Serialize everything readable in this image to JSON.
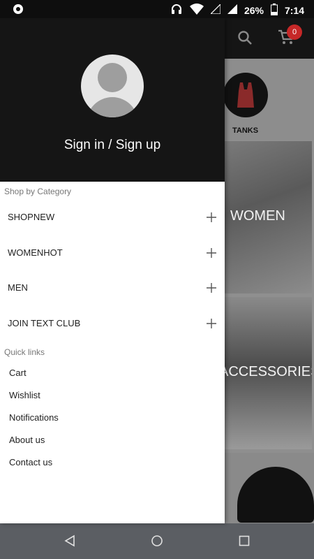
{
  "status_bar": {
    "battery_percent": "26%",
    "time": "7:14",
    "icons": [
      "notification-icon",
      "headphones-icon",
      "wifi-icon",
      "signal-empty-icon",
      "signal-icon",
      "battery-icon"
    ]
  },
  "app_header": {
    "cart_count": "0",
    "icons": [
      "search-icon",
      "cart-icon"
    ]
  },
  "background": {
    "category_label": "TANKS",
    "banners": [
      "WOMEN",
      "ACCESSORIES"
    ]
  },
  "drawer": {
    "signin_label": "Sign in / Sign up",
    "shop_by_category_label": "Shop by Category",
    "categories": [
      {
        "label": "SHOPNEW"
      },
      {
        "label": "WOMENHOT"
      },
      {
        "label": "MEN"
      },
      {
        "label": "JOIN TEXT CLUB"
      }
    ],
    "quick_links_label": "Quick links",
    "quick_links": [
      {
        "label": "Cart"
      },
      {
        "label": "Wishlist"
      },
      {
        "label": "Notifications"
      },
      {
        "label": "About us"
      },
      {
        "label": "Contact us"
      }
    ]
  },
  "nav_bar": {
    "icons": [
      "back-icon",
      "home-icon",
      "recents-icon"
    ]
  },
  "colors": {
    "header_bg": "#151515",
    "badge": "#c62828",
    "nav_bar": "#5b5e63"
  }
}
